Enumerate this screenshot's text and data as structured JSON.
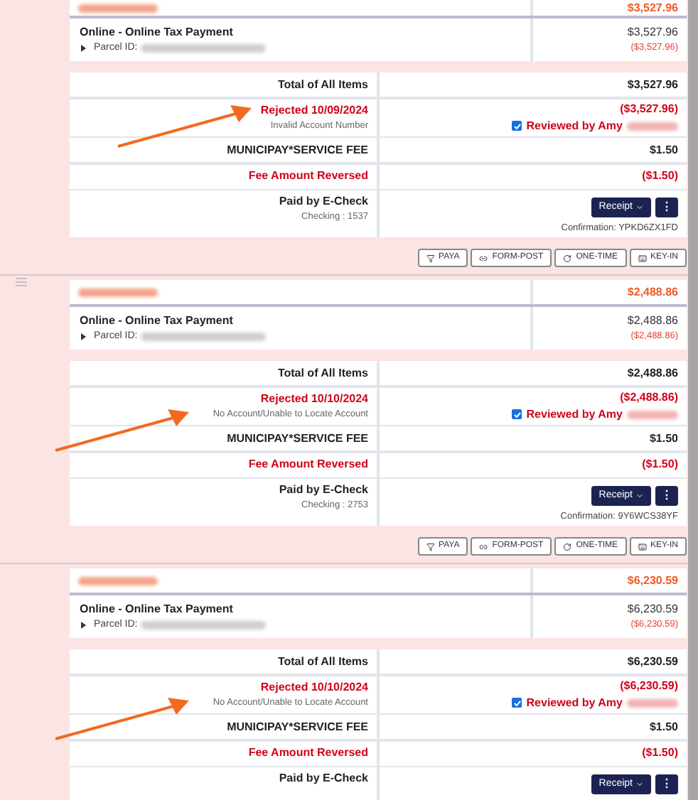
{
  "records": [
    {
      "header_amount": "$3,527.96",
      "item": {
        "title": "Online - Online Tax Payment",
        "parcel_label": "Parcel ID:",
        "amount": "$3,527.96",
        "reversed": "($3,527.96)"
      },
      "total_label": "Total of All Items",
      "total": "$3,527.96",
      "rejected": "Rejected 10/09/2024",
      "reason": "Invalid Account Number",
      "rejected_amount": "($3,527.96)",
      "reviewed": {
        "checked": true,
        "label": "Reviewed by Amy"
      },
      "fee_label": "MUNICIPAY*SERVICE FEE",
      "fee": "$1.50",
      "fee_reversed_label": "Fee Amount Reversed",
      "fee_reversed": "($1.50)",
      "paid_by": "Paid by E-Check",
      "account": "Checking : 1537",
      "receipt": "Receipt",
      "more": "⋮",
      "confirmation": "Confirmation: YPKD6ZX1FD",
      "methods": [
        "PAYA",
        "FORM-POST",
        "ONE-TIME",
        "KEY-IN"
      ],
      "arrow": true,
      "drag_handle": false
    },
    {
      "header_amount": "$2,488.86",
      "item": {
        "title": "Online - Online Tax Payment",
        "parcel_label": "Parcel ID:",
        "amount": "$2,488.86",
        "reversed": "($2,488.86)"
      },
      "total_label": "Total of All Items",
      "total": "$2,488.86",
      "rejected": "Rejected 10/10/2024",
      "reason": "No Account/Unable to Locate Account",
      "rejected_amount": "($2,488.86)",
      "reviewed": {
        "checked": true,
        "label": "Reviewed by Amy"
      },
      "fee_label": "MUNICIPAY*SERVICE FEE",
      "fee": "$1.50",
      "fee_reversed_label": "Fee Amount Reversed",
      "fee_reversed": "($1.50)",
      "paid_by": "Paid by E-Check",
      "account": "Checking : 2753",
      "receipt": "Receipt",
      "more": "⋮",
      "confirmation": "Confirmation: 9Y6WCS38YF",
      "methods": [
        "PAYA",
        "FORM-POST",
        "ONE-TIME",
        "KEY-IN"
      ],
      "arrow": true,
      "drag_handle": true
    },
    {
      "header_amount": "$6,230.59",
      "item": {
        "title": "Online - Online Tax Payment",
        "parcel_label": "Parcel ID:",
        "amount": "$6,230.59",
        "reversed": "($6,230.59)"
      },
      "total_label": "Total of All Items",
      "total": "$6,230.59",
      "rejected": "Rejected 10/10/2024",
      "reason": "No Account/Unable to Locate Account",
      "rejected_amount": "($6,230.59)",
      "reviewed": {
        "checked": true,
        "label": "Reviewed by Amy"
      },
      "fee_label": "MUNICIPAY*SERVICE FEE",
      "fee": "$1.50",
      "fee_reversed_label": "Fee Amount Reversed",
      "fee_reversed": "($1.50)",
      "paid_by": "Paid by E-Check",
      "receipt": "Receipt",
      "more": "⋮",
      "arrow": true,
      "drag_handle": false
    }
  ]
}
